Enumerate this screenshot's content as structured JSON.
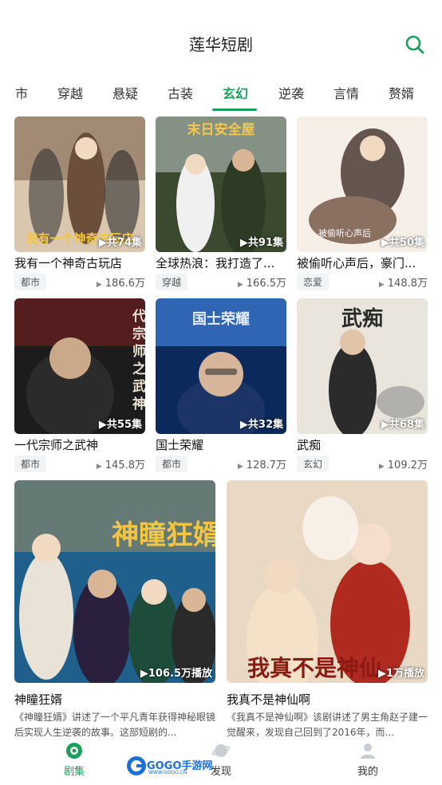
{
  "app": {
    "title": "莲华短剧"
  },
  "header": {
    "search_icon": "search-icon"
  },
  "tabs": [
    {
      "label": "市"
    },
    {
      "label": "穿越"
    },
    {
      "label": "悬疑"
    },
    {
      "label": "古装"
    },
    {
      "label": "玄幻",
      "active": true
    },
    {
      "label": "逆袭"
    },
    {
      "label": "言情"
    },
    {
      "label": "赘婿"
    }
  ],
  "grid": [
    {
      "title": "我有一个神奇古玩店",
      "tag": "都市",
      "views": "186.6万",
      "episodes": "共74集",
      "poster_text": "我有一个神奇古玩店",
      "colors": [
        "#6b4f3a",
        "#d9c7b0",
        "#2a2a2a"
      ]
    },
    {
      "title": "全球热浪：我打造了...",
      "tag": "穿越",
      "views": "166.5万",
      "episodes": "共91集",
      "poster_text": "末日安全屋",
      "colors": [
        "#3b4a2e",
        "#cfd8dc",
        "#f2c94c"
      ]
    },
    {
      "title": "被偷听心声后，豪门...",
      "tag": "恋爱",
      "views": "148.8万",
      "episodes": "共50集",
      "poster_text": "被偷听心声后",
      "colors": [
        "#4a3b32",
        "#f5efe8",
        "#8a7060"
      ]
    },
    {
      "title": "一代宗师之武神",
      "tag": "都市",
      "views": "145.8万",
      "episodes": "共55集",
      "poster_text": "一代宗师之武神",
      "colors": [
        "#1c1c1c",
        "#7a1f1f",
        "#e8e0d0"
      ]
    },
    {
      "title": "国士荣耀",
      "tag": "都市",
      "views": "128.7万",
      "episodes": "共32集",
      "poster_text": "国士荣耀",
      "colors": [
        "#0b2a5b",
        "#3f7fd8",
        "#e6eefc"
      ]
    },
    {
      "title": "武痴",
      "tag": "玄幻",
      "views": "109.2万",
      "episodes": "共68集",
      "poster_text": "武痴",
      "colors": [
        "#e9e5dc",
        "#2b2b2b",
        "#8c8c8c"
      ]
    }
  ],
  "featured": [
    {
      "title": "神瞳狂婿",
      "plays": "106.5万播放",
      "poster_text": "神瞳狂婿",
      "desc": "《神瞳狂婿》讲述了一个平凡青年获得神秘眼镜后实现人生逆袭的故事。这部短剧的...",
      "colors": [
        "#1f5f8b",
        "#e8b04a",
        "#2a1f3d"
      ]
    },
    {
      "title": "我真不是神仙啊",
      "plays": "1万播放",
      "poster_text": "我真不是神仙",
      "desc": "《我真不是神仙啊》该剧讲述了男主角赵子建一觉醒来，发现自己回到了2016年，而...",
      "colors": [
        "#e9d9c4",
        "#b02a1f",
        "#f4e1c8"
      ]
    }
  ],
  "bottom_nav": [
    {
      "label": "剧集",
      "icon": "play-circle-icon",
      "active": true
    },
    {
      "label": "发现",
      "icon": "planet-icon"
    },
    {
      "label": "我的",
      "icon": "person-icon"
    }
  ],
  "watermark": {
    "text": "GOGO手游网",
    "sub": "WWW.GOGO.CN"
  },
  "theme": {
    "accent": "#1aa05a"
  }
}
